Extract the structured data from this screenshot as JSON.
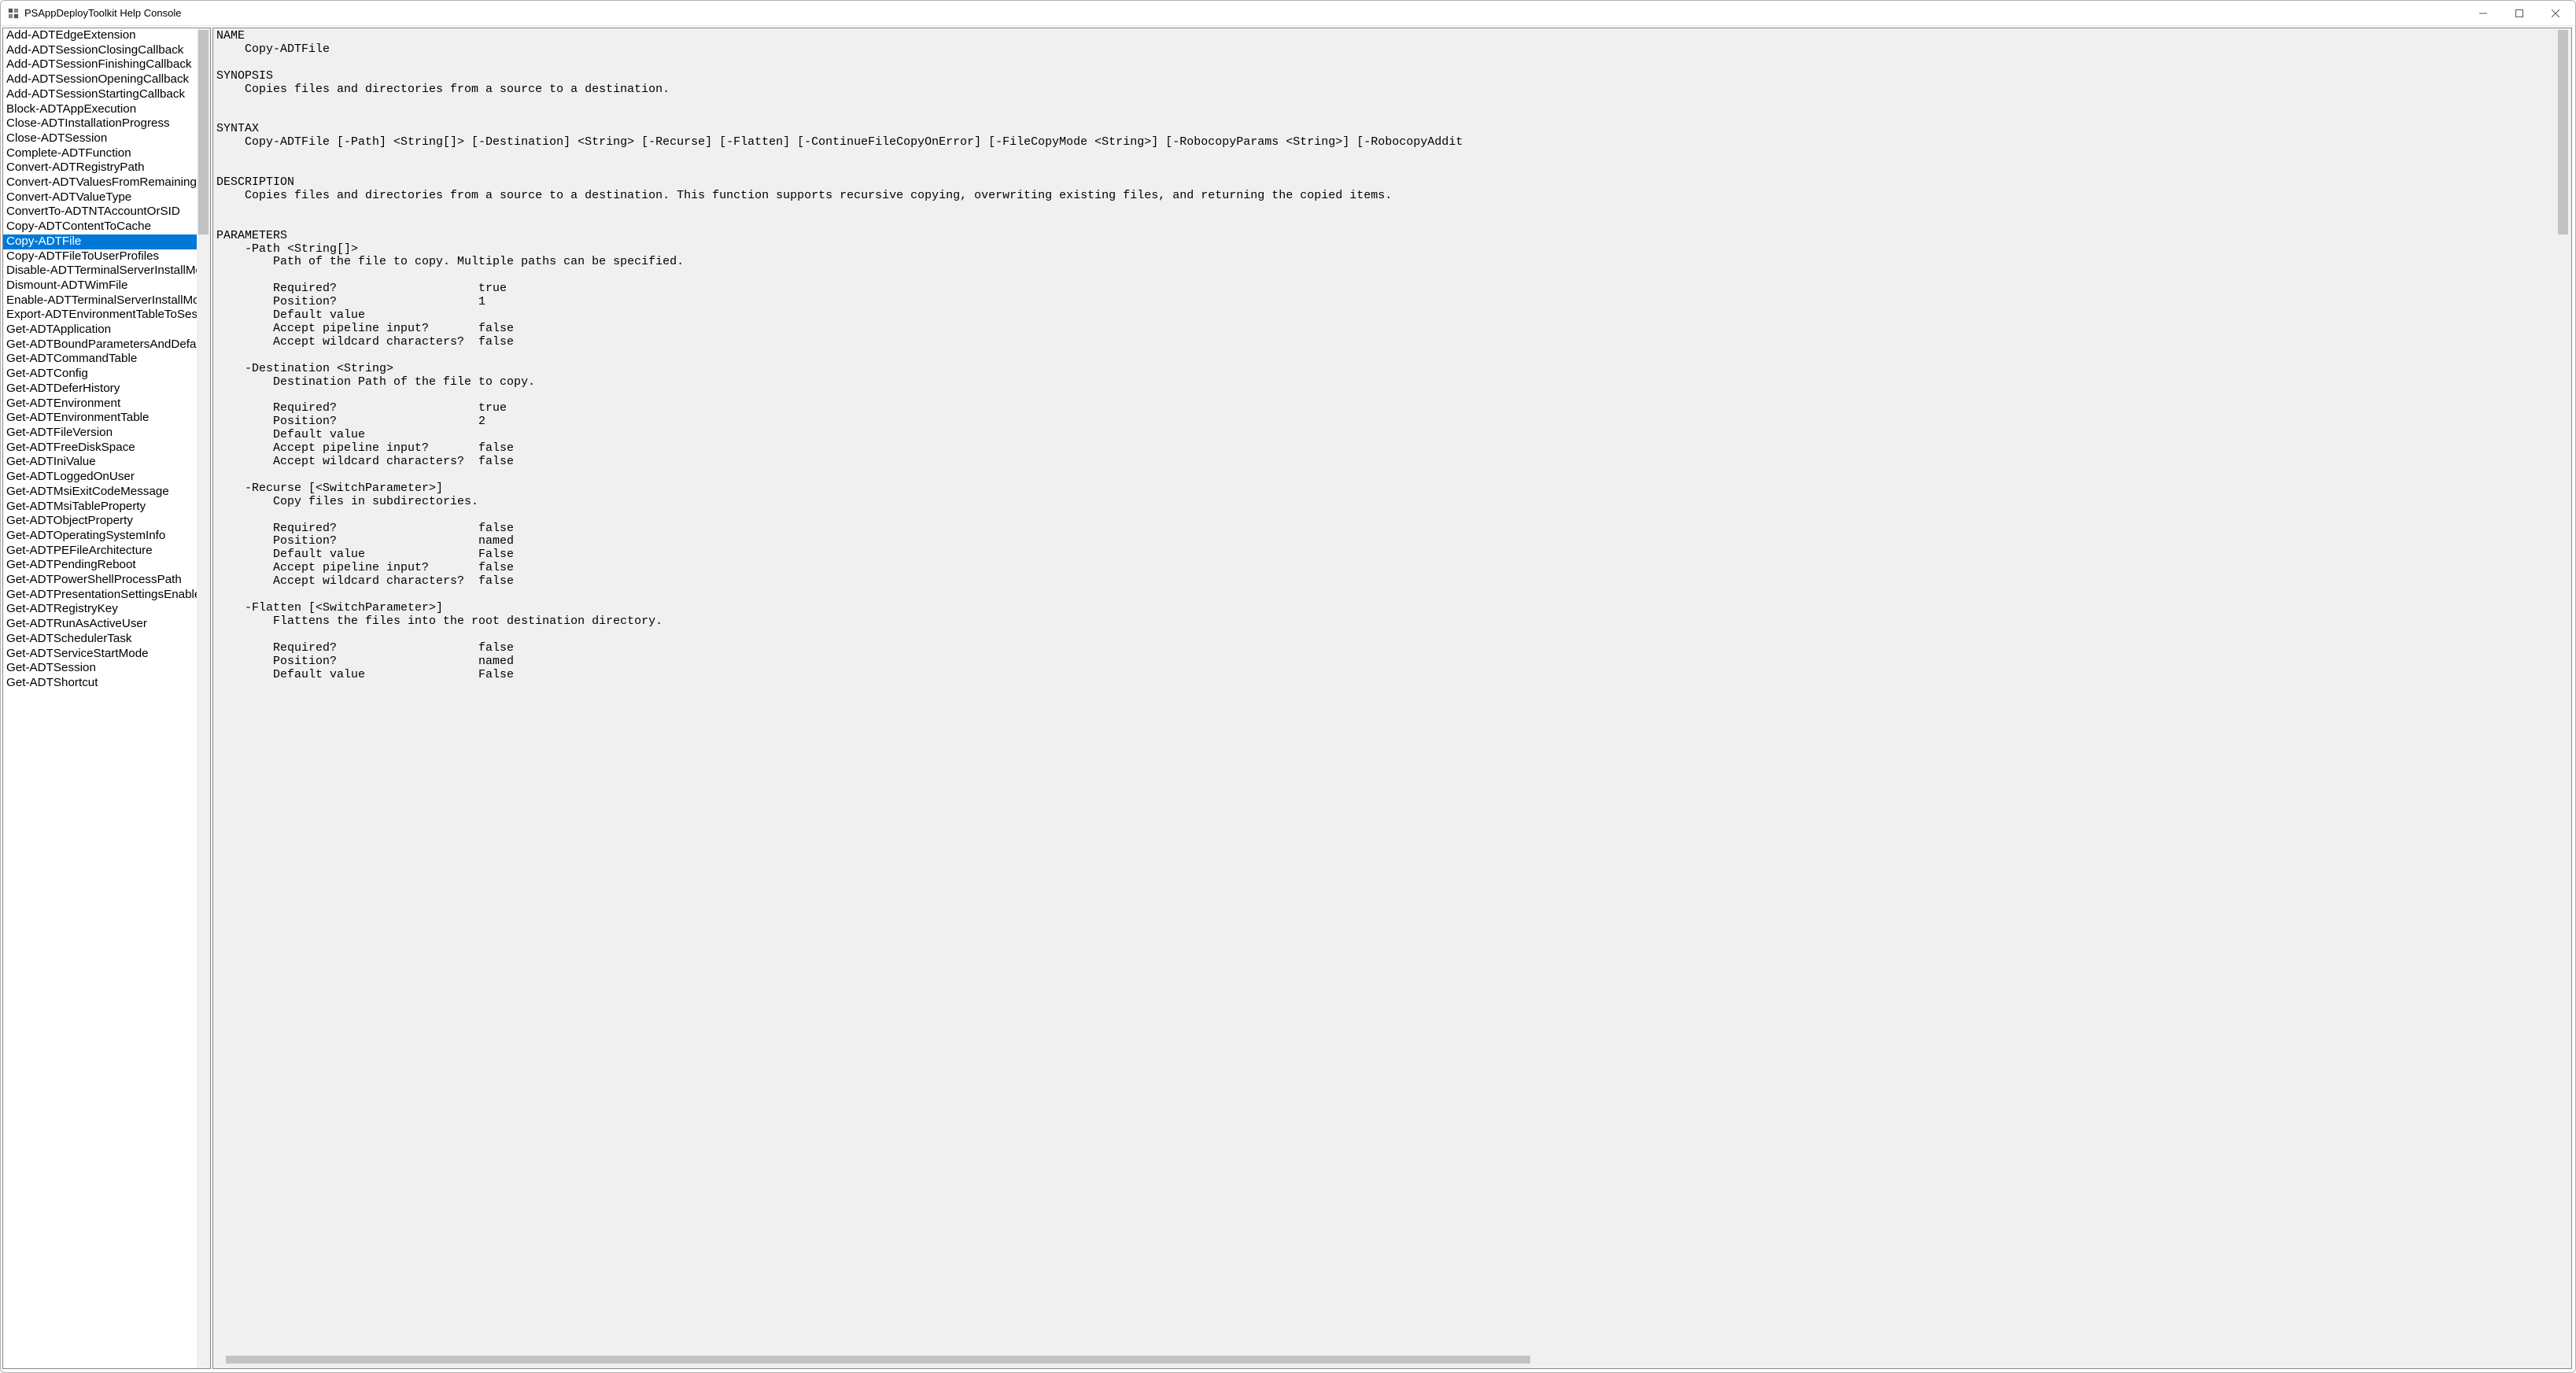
{
  "window": {
    "title": "PSAppDeployToolkit Help Console"
  },
  "sidebar": {
    "selected_index": 14,
    "items": [
      "Add-ADTEdgeExtension",
      "Add-ADTSessionClosingCallback",
      "Add-ADTSessionFinishingCallback",
      "Add-ADTSessionOpeningCallback",
      "Add-ADTSessionStartingCallback",
      "Block-ADTAppExecution",
      "Close-ADTInstallationProgress",
      "Close-ADTSession",
      "Complete-ADTFunction",
      "Convert-ADTRegistryPath",
      "Convert-ADTValuesFromRemainingArguments",
      "Convert-ADTValueType",
      "ConvertTo-ADTNTAccountOrSID",
      "Copy-ADTContentToCache",
      "Copy-ADTFile",
      "Copy-ADTFileToUserProfiles",
      "Disable-ADTTerminalServerInstallMode",
      "Dismount-ADTWimFile",
      "Enable-ADTTerminalServerInstallMode",
      "Export-ADTEnvironmentTableToSessionState",
      "Get-ADTApplication",
      "Get-ADTBoundParametersAndDefaultValues",
      "Get-ADTCommandTable",
      "Get-ADTConfig",
      "Get-ADTDeferHistory",
      "Get-ADTEnvironment",
      "Get-ADTEnvironmentTable",
      "Get-ADTFileVersion",
      "Get-ADTFreeDiskSpace",
      "Get-ADTIniValue",
      "Get-ADTLoggedOnUser",
      "Get-ADTMsiExitCodeMessage",
      "Get-ADTMsiTableProperty",
      "Get-ADTObjectProperty",
      "Get-ADTOperatingSystemInfo",
      "Get-ADTPEFileArchitecture",
      "Get-ADTPendingReboot",
      "Get-ADTPowerShellProcessPath",
      "Get-ADTPresentationSettingsEnabledUsers",
      "Get-ADTRegistryKey",
      "Get-ADTRunAsActiveUser",
      "Get-ADTSchedulerTask",
      "Get-ADTServiceStartMode",
      "Get-ADTSession",
      "Get-ADTShortcut"
    ]
  },
  "help": {
    "text": "NAME\n    Copy-ADTFile\n\nSYNOPSIS\n    Copies files and directories from a source to a destination.\n\n\nSYNTAX\n    Copy-ADTFile [-Path] <String[]> [-Destination] <String> [-Recurse] [-Flatten] [-ContinueFileCopyOnError] [-FileCopyMode <String>] [-RobocopyParams <String>] [-RobocopyAddit\n\n\nDESCRIPTION\n    Copies files and directories from a source to a destination. This function supports recursive copying, overwriting existing files, and returning the copied items.\n\n\nPARAMETERS\n    -Path <String[]>\n        Path of the file to copy. Multiple paths can be specified.\n\n        Required?                    true\n        Position?                    1\n        Default value\n        Accept pipeline input?       false\n        Accept wildcard characters?  false\n\n    -Destination <String>\n        Destination Path of the file to copy.\n\n        Required?                    true\n        Position?                    2\n        Default value\n        Accept pipeline input?       false\n        Accept wildcard characters?  false\n\n    -Recurse [<SwitchParameter>]\n        Copy files in subdirectories.\n\n        Required?                    false\n        Position?                    named\n        Default value                False\n        Accept pipeline input?       false\n        Accept wildcard characters?  false\n\n    -Flatten [<SwitchParameter>]\n        Flattens the files into the root destination directory.\n\n        Required?                    false\n        Position?                    named\n        Default value                False\n"
  }
}
